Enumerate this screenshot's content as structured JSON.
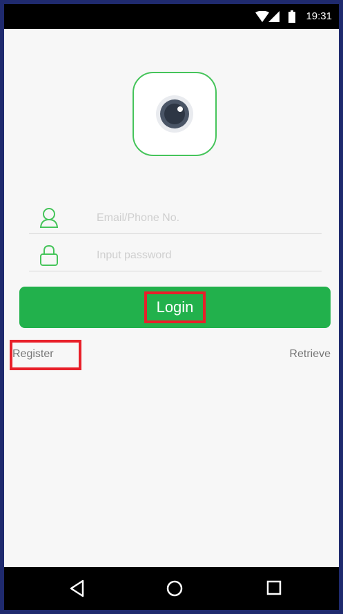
{
  "status_bar": {
    "time": "19:31",
    "icons": [
      "wifi-icon",
      "signal-icon",
      "battery-icon"
    ]
  },
  "logo": {
    "icon": "camera-icon",
    "accent_color": "#45c45a"
  },
  "form": {
    "email": {
      "placeholder": "Email/Phone No.",
      "value": "",
      "icon": "user-icon"
    },
    "password": {
      "placeholder": "Input password",
      "value": "",
      "icon": "lock-icon"
    }
  },
  "actions": {
    "login_label": "Login",
    "register_label": "Register",
    "retrieve_label": "Retrieve",
    "login_color": "#22b14c",
    "highlight_color": "#e8202a"
  },
  "nav_bar": {
    "icons": [
      "back-icon",
      "home-icon",
      "recents-icon"
    ]
  }
}
